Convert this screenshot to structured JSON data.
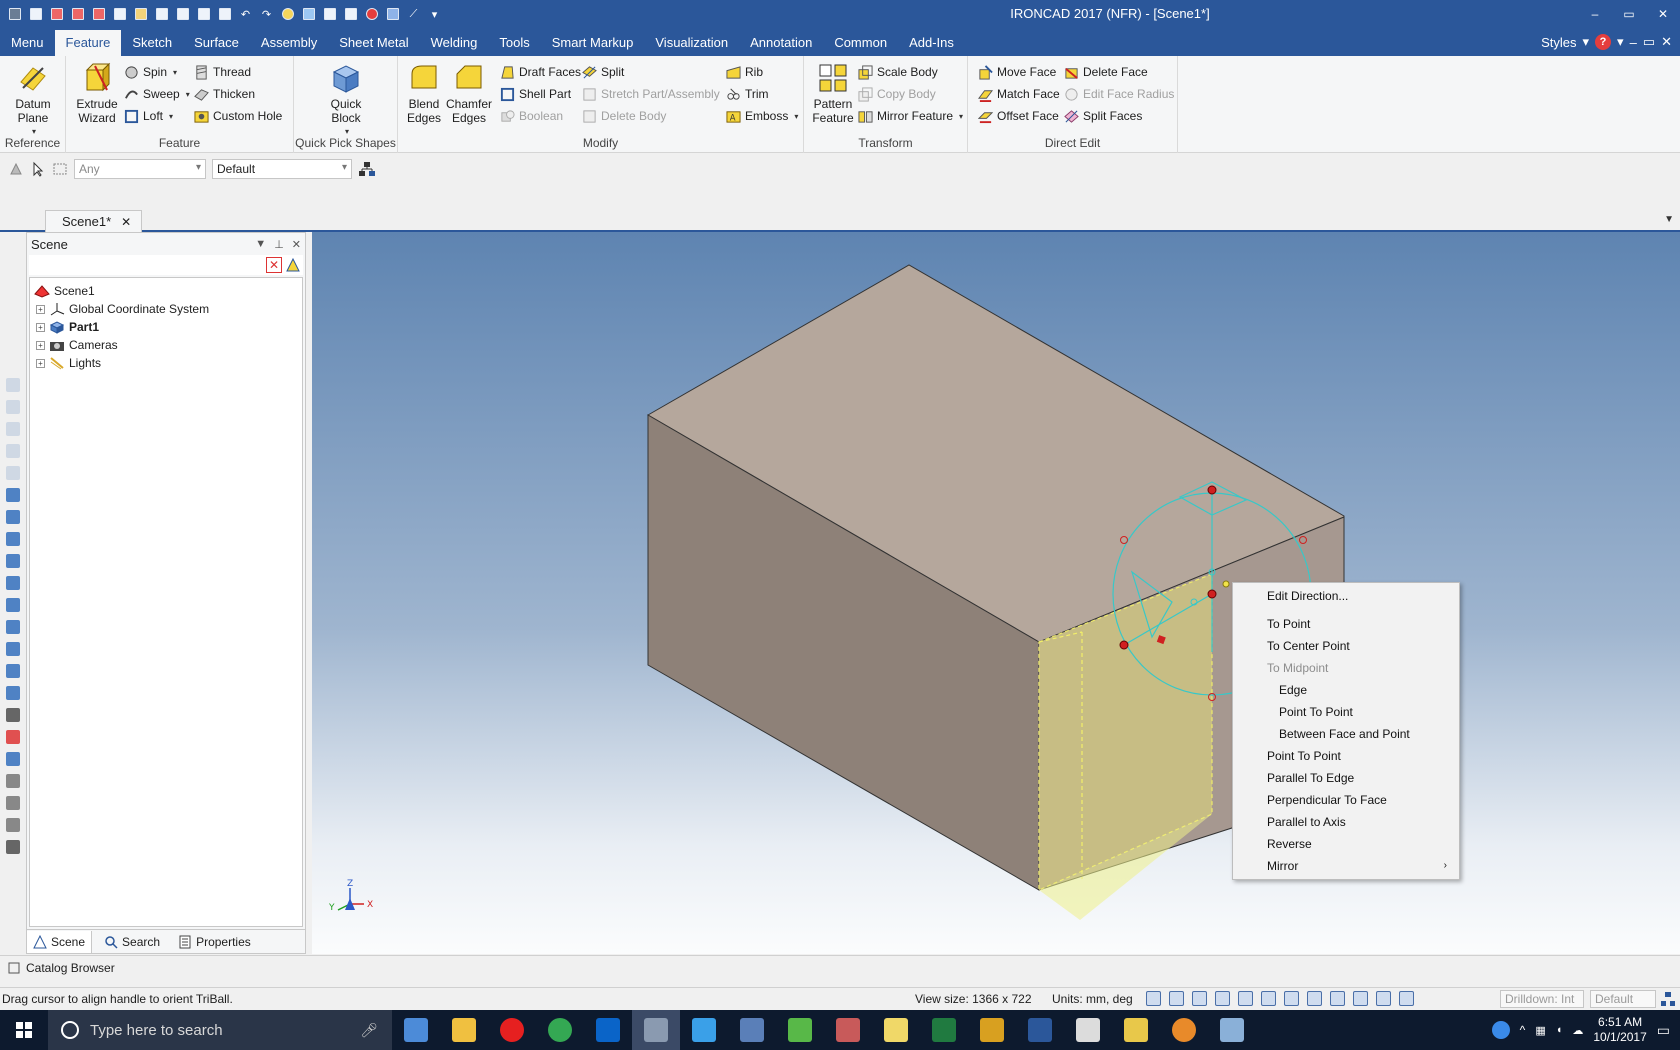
{
  "window": {
    "title": "IRONCAD 2017 (NFR) - [Scene1*]",
    "controls": [
      "–",
      "▭",
      "✕"
    ]
  },
  "ribbon_tabs": [
    "Menu",
    "Feature",
    "Sketch",
    "Surface",
    "Assembly",
    "Sheet Metal",
    "Welding",
    "Tools",
    "Smart Markup",
    "Visualization",
    "Annotation",
    "Common",
    "Add-Ins"
  ],
  "active_tab": "Feature",
  "tabbar_right": {
    "styles": "Styles",
    "help": "?"
  },
  "groups": {
    "reference": {
      "label": "Reference",
      "datum_plane": "Datum Plane"
    },
    "feature": {
      "label": "Feature",
      "extrude": "Extrude Wizard",
      "spin": "Spin",
      "sweep": "Sweep",
      "loft": "Loft",
      "thread": "Thread",
      "thicken": "Thicken",
      "custom_hole": "Custom Hole"
    },
    "quick_pick": {
      "label": "Quick Pick Shapes",
      "quick_block": "Quick Block"
    },
    "modify": {
      "label": "Modify",
      "blend": "Blend Edges",
      "chamfer": "Chamfer Edges",
      "draft_faces": "Draft Faces",
      "shell_part": "Shell Part",
      "boolean": "Boolean",
      "split": "Split",
      "stretch": "Stretch Part/Assembly",
      "delete_body": "Delete Body",
      "rib": "Rib",
      "trim": "Trim",
      "emboss": "Emboss"
    },
    "transform": {
      "label": "Transform",
      "pattern": "Pattern Feature",
      "scale_body": "Scale Body",
      "copy_body": "Copy Body",
      "mirror_feature": "Mirror Feature"
    },
    "direct_edit": {
      "label": "Direct Edit",
      "move_face": "Move Face",
      "match_face": "Match Face",
      "offset_face": "Offset Face",
      "delete_face": "Delete Face",
      "edit_face_radius": "Edit Face Radius",
      "split_faces": "Split Faces"
    }
  },
  "toolbar2": {
    "filter": "Any",
    "style": "Default"
  },
  "doc_tab": "Scene1*",
  "scene_panel": {
    "title": "Scene",
    "tree": [
      {
        "label": "Scene1",
        "bold": false,
        "root": true
      },
      {
        "label": "Global Coordinate System",
        "bold": false
      },
      {
        "label": "Part1",
        "bold": true
      },
      {
        "label": "Cameras",
        "bold": false
      },
      {
        "label": "Lights",
        "bold": false
      }
    ],
    "tabs": [
      "Scene",
      "Search",
      "Properties"
    ]
  },
  "context_menu": {
    "items": [
      {
        "label": "Edit Direction...",
        "level": 0,
        "enabled": true,
        "sep_after": true
      },
      {
        "label": "To Point",
        "level": 0,
        "enabled": true
      },
      {
        "label": "To Center Point",
        "level": 0,
        "enabled": true
      },
      {
        "label": "To Midpoint",
        "level": 0,
        "enabled": false
      },
      {
        "label": "Edge",
        "level": 1,
        "enabled": true
      },
      {
        "label": "Point To Point",
        "level": 1,
        "enabled": true
      },
      {
        "label": "Between Face and Point",
        "level": 1,
        "enabled": true
      },
      {
        "label": "Point To Point",
        "level": 0,
        "enabled": true
      },
      {
        "label": "Parallel To Edge",
        "level": 0,
        "enabled": true
      },
      {
        "label": "Perpendicular To Face",
        "level": 0,
        "enabled": true
      },
      {
        "label": "Parallel to Axis",
        "level": 0,
        "enabled": true
      },
      {
        "label": "Reverse",
        "level": 0,
        "enabled": true
      },
      {
        "label": "Mirror",
        "level": 0,
        "enabled": true,
        "submenu": true
      }
    ]
  },
  "axis_labels": {
    "x": "X",
    "y": "Y",
    "z": "Z"
  },
  "catalog": "Catalog Browser",
  "status": {
    "message": "Drag cursor to align handle to orient TriBall.",
    "view_size": "View size: 1366 x  722",
    "units": "Units: mm, deg",
    "drilldown": "Drilldown: Int",
    "default": "Default"
  },
  "taskbar": {
    "search_placeholder": "Type here to search",
    "time": "6:51 AM",
    "date": "10/1/2017"
  },
  "colors": {
    "accent": "#2b579a",
    "part_top": "#b5a79c",
    "part_left": "#8e8178",
    "part_right": "#a69890",
    "highlight_face": "#c8be82",
    "triball": "#38c8c8"
  }
}
